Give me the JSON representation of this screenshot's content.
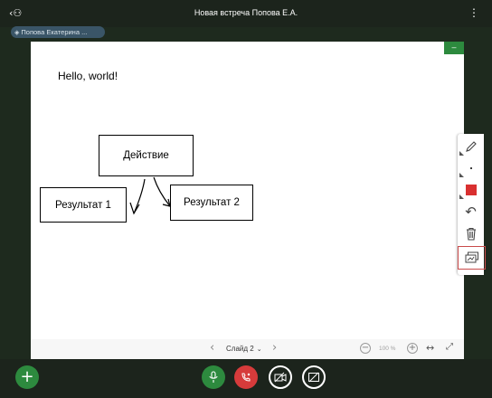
{
  "header": {
    "title": "Новая встреча Попова Е.А.",
    "user_icon": "user-list-icon",
    "more_icon": "more-vertical-icon"
  },
  "presenter": {
    "name": "Попова Екатерина ...",
    "icon": "presenter-icon"
  },
  "slide": {
    "text": "Hello, world!",
    "boxes": [
      "Действие",
      "Результат 1",
      "Результат 2"
    ],
    "minimize_icon": "minimize-icon"
  },
  "slide_nav": {
    "current": "Слайд 2",
    "zoom": "100 %"
  },
  "tools": [
    "pencil-icon",
    "thickness-icon",
    "color-icon",
    "undo-icon",
    "clear-icon",
    "multi-user-icon"
  ],
  "colors": {
    "accent_green": "#2d8a3e",
    "hangup_red": "#d63b3b",
    "draw_color": "#d93030"
  }
}
